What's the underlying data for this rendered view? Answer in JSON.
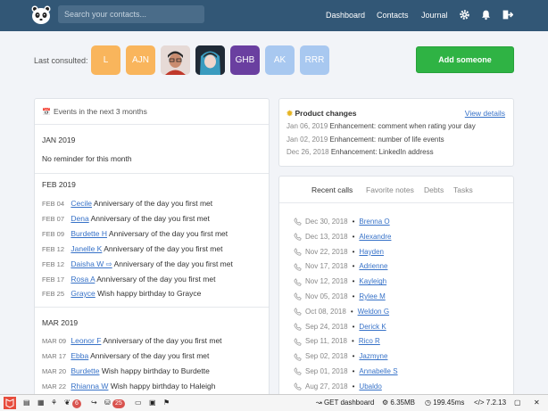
{
  "header": {
    "search_placeholder": "Search your contacts...",
    "nav": [
      "Dashboard",
      "Contacts",
      "Journal"
    ]
  },
  "last_consulted": {
    "label": "Last consulted:",
    "avatars": [
      {
        "text": "L",
        "color": "#f9b55c"
      },
      {
        "text": "AJN",
        "color": "#f9b55c"
      },
      {
        "text": "",
        "color": "#d88a76",
        "photo": true
      },
      {
        "text": "",
        "color": "#2b3b4a",
        "photo": true
      },
      {
        "text": "GHB",
        "color": "#6a3fa0"
      },
      {
        "text": "AK",
        "color": "#a8c8f0"
      },
      {
        "text": "RRR",
        "color": "#a8c8f0"
      }
    ],
    "add_button": "Add someone"
  },
  "events": {
    "title": "Events in the next 3 months",
    "months": [
      {
        "name": "JAN 2019",
        "empty": "No reminder for this month"
      },
      {
        "name": "FEB 2019"
      },
      {
        "name": "MAR 2019"
      }
    ],
    "feb": [
      {
        "date": "FEB 04",
        "name": "Cecile",
        "text": "Anniversary of the day you first met"
      },
      {
        "date": "FEB 07",
        "name": "Dena",
        "text": "Anniversary of the day you first met"
      },
      {
        "date": "FEB 09",
        "name": "Burdette H",
        "text": "Anniversary of the day you first met"
      },
      {
        "date": "FEB 12",
        "name": "Janelle K",
        "text": "Anniversary of the day you first met"
      },
      {
        "date": "FEB 12",
        "name": "Daisha W ⇨",
        "text": "Anniversary of the day you first met"
      },
      {
        "date": "FEB 17",
        "name": "Rosa A",
        "text": "Anniversary of the day you first met"
      },
      {
        "date": "FEB 25",
        "name": "Grayce",
        "text": "Wish happy birthday to Grayce"
      }
    ],
    "mar": [
      {
        "date": "MAR 09",
        "name": "Leonor F",
        "text": "Anniversary of the day you first met"
      },
      {
        "date": "MAR 17",
        "name": "Ebba",
        "text": "Anniversary of the day you first met"
      },
      {
        "date": "MAR 20",
        "name": "Burdette",
        "text": "Wish happy birthday to Burdette"
      },
      {
        "date": "MAR 22",
        "name": "Rhianna W",
        "text": "Wish happy birthday to Haleigh"
      }
    ]
  },
  "product": {
    "title": "Product changes",
    "view_details": "View details",
    "items": [
      {
        "date": "Jan 06, 2019",
        "text": "Enhancement: comment when rating your day"
      },
      {
        "date": "Jan 02, 2019",
        "text": "Enhancement: number of life events"
      },
      {
        "date": "Dec 26, 2018",
        "text": "Enhancement: LinkedIn address"
      }
    ]
  },
  "calls": {
    "tabs": [
      "Recent calls",
      "Favorite notes",
      "Debts",
      "Tasks"
    ],
    "items": [
      {
        "date": "Dec 30, 2018",
        "name": "Brenna O"
      },
      {
        "date": "Dec 13, 2018",
        "name": "Alexandre"
      },
      {
        "date": "Nov 22, 2018",
        "name": "Hayden"
      },
      {
        "date": "Nov 17, 2018",
        "name": "Adrienne"
      },
      {
        "date": "Nov 12, 2018",
        "name": "Kayleigh"
      },
      {
        "date": "Nov 05, 2018",
        "name": "Rylee M"
      },
      {
        "date": "Oct 08, 2018",
        "name": "Weldon G"
      },
      {
        "date": "Sep 24, 2018",
        "name": "Derick K"
      },
      {
        "date": "Sep 11, 2018",
        "name": "Rico R"
      },
      {
        "date": "Sep 02, 2018",
        "name": "Jazmyne"
      },
      {
        "date": "Sep 01, 2018",
        "name": "Annabelle S"
      },
      {
        "date": "Aug 27, 2018",
        "name": "Ubaldo"
      }
    ]
  },
  "debug": {
    "badge1": "6",
    "badge2": "25",
    "route": "GET dashboard",
    "memory": "6.35MB",
    "time": "199.45ms",
    "version": "7.2.13"
  }
}
